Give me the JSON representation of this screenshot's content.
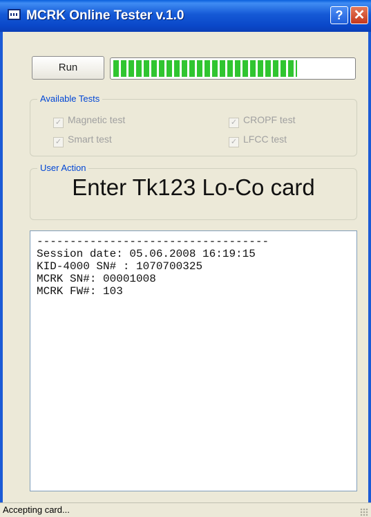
{
  "window": {
    "title": "MCRK Online Tester v.1.0",
    "help_label": "?",
    "close_label": "✕"
  },
  "toolbar": {
    "run_label": "Run",
    "progress_percent": 77
  },
  "tests_group": {
    "label": "Available Tests",
    "items": [
      {
        "label": "Magnetic test",
        "checked": true,
        "enabled": false
      },
      {
        "label": "Smart test",
        "checked": true,
        "enabled": false
      },
      {
        "label": "CROPF test",
        "checked": true,
        "enabled": false
      },
      {
        "label": "LFCC test",
        "checked": true,
        "enabled": false
      }
    ]
  },
  "action_group": {
    "label": "User Action",
    "text": "Enter Tk123 Lo-Co card"
  },
  "log": {
    "lines": [
      "-----------------------------------",
      "Session date: 05.06.2008 16:19:15",
      "KID-4000 SN# : 1070700325",
      "MCRK SN#: 00001008",
      "MCRK FW#: 103"
    ]
  },
  "status": {
    "text": "Accepting card..."
  },
  "colors": {
    "titlebar": "#0a48c9",
    "group_label": "#0046d5",
    "progress_fill": "#30c530",
    "face": "#ece9d8"
  }
}
